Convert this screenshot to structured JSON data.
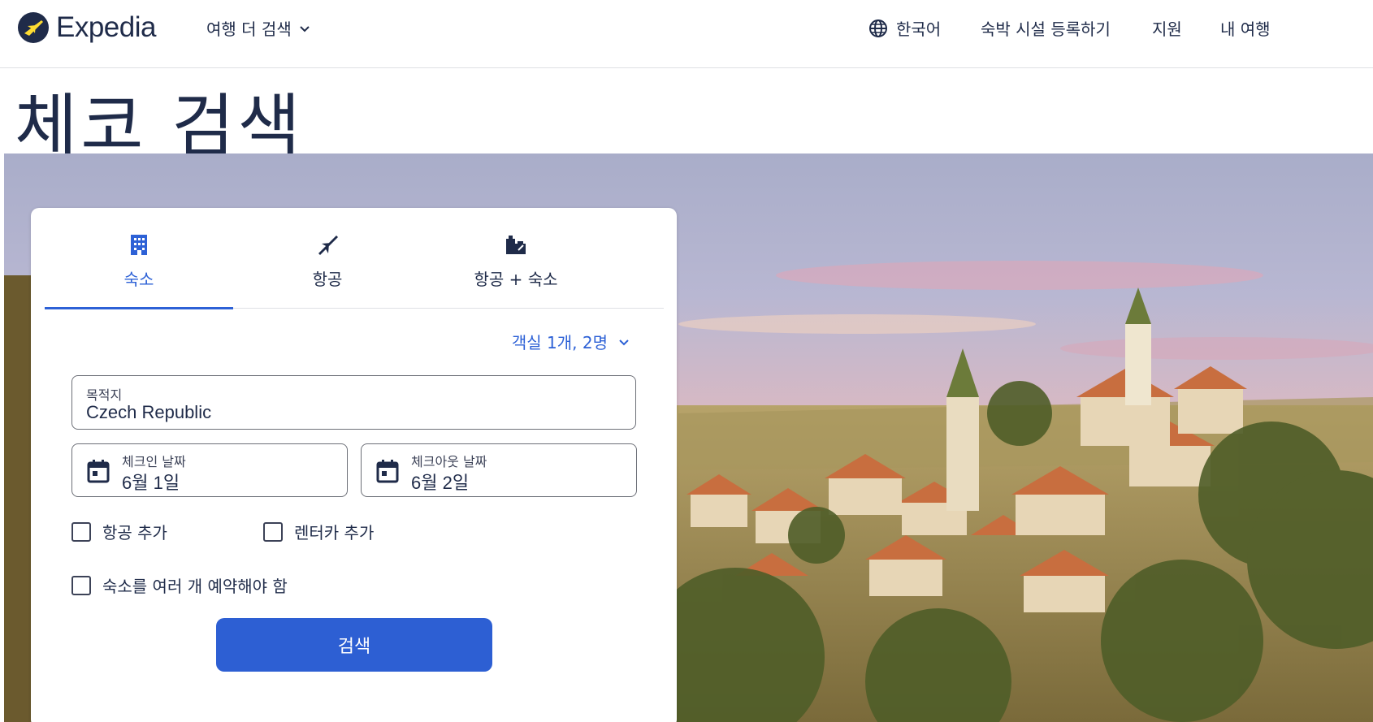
{
  "header": {
    "logo_text": "Expedia",
    "nav_more": "여행 더 검색",
    "language": "한국어",
    "list_property": "숙박 시설 등록하기",
    "support": "지원",
    "my_trips": "내 여행"
  },
  "page": {
    "title": "체코 검색"
  },
  "search": {
    "tabs": [
      {
        "label": "숙소",
        "icon": "building-icon",
        "active": true
      },
      {
        "label": "항공",
        "icon": "airplane-icon",
        "active": false
      },
      {
        "label": "항공 + 숙소",
        "icon": "package-icon",
        "active": false
      }
    ],
    "rooms_summary": "객실 1개, 2명",
    "destination": {
      "label": "목적지",
      "value": "Czech Republic"
    },
    "checkin": {
      "label": "체크인 날짜",
      "value": "6월 1일"
    },
    "checkout": {
      "label": "체크아웃 날짜",
      "value": "6월 2일"
    },
    "add_flight": "항공 추가",
    "add_car": "렌터카 추가",
    "multi_stay": "숙소를 여러 개 예약해야 함",
    "search_button": "검색"
  },
  "colors": {
    "brand_blue": "#2d61d6",
    "text_dark": "#1f2b49",
    "logo_yellow": "#fddb32"
  }
}
